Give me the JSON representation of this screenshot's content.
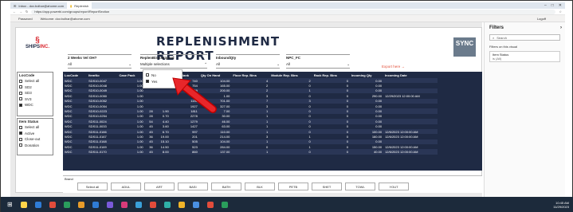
{
  "browser": {
    "tabs": [
      {
        "label": "Inbox - dov.bolhar@ahome.com"
      },
      {
        "label": "Replenish"
      }
    ],
    "url": "https://app.powerbi.com/groups/report/ReportSection",
    "window_controls": [
      "–",
      "□",
      "✕"
    ]
  },
  "pbi_bar": {
    "items": [
      "Password",
      "Welcome: dov.bolhar@ahome.com"
    ],
    "logoff": "Logoff"
  },
  "report": {
    "logo_brand": "SHIPS",
    "logo_suffix": "INC.",
    "title": "REPLENISHMENT REPORT",
    "sync_logo": "SYNC",
    "export_label": "Export here"
  },
  "slicers": [
    {
      "label": "2 Weeks Vel OH?",
      "value": "All"
    },
    {
      "label": "ReplenBinAssigned",
      "value": "Multiple selections"
    },
    {
      "label": "InboundQty",
      "value": "All"
    },
    {
      "label": "NPC_FC",
      "value": "All"
    }
  ],
  "replen_dropdown": {
    "options": [
      {
        "label": "No",
        "checked": false
      },
      {
        "label": "Yes",
        "checked": true
      }
    ]
  },
  "loc_code": {
    "header": "LocCode",
    "options": [
      {
        "label": "Select all",
        "checked": false
      },
      {
        "label": "SD2",
        "checked": false
      },
      {
        "label": "SD3",
        "checked": false
      },
      {
        "label": "SV3",
        "checked": false
      },
      {
        "label": "WDC",
        "checked": true
      }
    ]
  },
  "item_status": {
    "header": "Item Status",
    "options": [
      {
        "label": "Select all",
        "checked": false
      },
      {
        "label": "Active",
        "checked": true
      },
      {
        "label": "Close-out",
        "checked": false
      },
      {
        "label": "Donation",
        "checked": false
      }
    ]
  },
  "table": {
    "columns": [
      "LocCode",
      "ItemNo",
      "Case Pack",
      "",
      "",
      "Sales Rank",
      "Qty On Hand",
      "Floor Rep. Bins",
      "Module Rep. Bins",
      "Rack Rep. Bins",
      "Incoming Qty",
      "Incoming Date"
    ],
    "rows": [
      [
        "WDC",
        "SDS10-0047",
        "1.00",
        "",
        "",
        "740",
        "104.00",
        "4",
        "2",
        "0",
        "0.00",
        ""
      ],
      [
        "WDC",
        "SDS10-0048",
        "1.00",
        "",
        "",
        "754",
        "165.00",
        "2",
        "0",
        "0",
        "0.00",
        ""
      ],
      [
        "WDC",
        "SDS10-0049",
        "1.00",
        "",
        "",
        "1059",
        "200.00",
        "2",
        "1",
        "0",
        "0.00",
        ""
      ],
      [
        "WDC",
        "SDS10-0050",
        "1.00",
        "",
        "",
        "840",
        "1.00",
        "3",
        "0",
        "0",
        "290.00",
        "12/29/2023 12:00:00 AM"
      ],
      [
        "WDC",
        "SDS10-0052",
        "1.00",
        "",
        "",
        "1150",
        "701.00",
        "7",
        "3",
        "0",
        "0.00",
        ""
      ],
      [
        "WDC",
        "SDS10-0054",
        "1.00",
        "",
        "",
        "1927",
        "327.00",
        "3",
        "0",
        "0",
        "0.00",
        ""
      ],
      [
        "WDC",
        "SDS10-0223",
        "1.00",
        "28",
        "1.90",
        "1811",
        "7.00",
        "1",
        "0",
        "0",
        "0.00",
        ""
      ],
      [
        "WDC",
        "SDS10-0254",
        "1.00",
        "28",
        "0.70",
        "2278",
        "30.00",
        "1",
        "0",
        "0",
        "0.00",
        ""
      ],
      [
        "WDC",
        "SDS11-0024",
        "1.00",
        "54",
        "4.40",
        "1279",
        "46.00",
        "1",
        "0",
        "0",
        "0.00",
        ""
      ],
      [
        "WDC",
        "SDS11-0033",
        "1.00",
        "45",
        "3.60",
        "1427",
        "63.00",
        "1",
        "0",
        "0",
        "0.00",
        ""
      ],
      [
        "WDC",
        "SDS11-0166",
        "1.00",
        "45",
        "6.70",
        "997",
        "110.00",
        "1",
        "0",
        "0",
        "100.00",
        "12/6/2023 12:00:00 AM"
      ],
      [
        "WDC",
        "SDS11-0167",
        "1.00",
        "36",
        "19.00",
        "201",
        "214.00",
        "3",
        "1",
        "0",
        "160.00",
        "12/6/2023 12:00:00 AM"
      ],
      [
        "WDC",
        "SDS11-0168",
        "1.00",
        "45",
        "15.10",
        "505",
        "104.00",
        "1",
        "0",
        "0",
        "0.00",
        ""
      ],
      [
        "WDC",
        "SDS11-0169",
        "1.00",
        "36",
        "14.50",
        "523",
        "284.00",
        "0",
        "1",
        "0",
        "150.00",
        "12/6/2023 12:00:00 AM"
      ],
      [
        "WDC",
        "SDS11-0170",
        "1.00",
        "45",
        "8.00",
        "860",
        "137.00",
        "1",
        "0",
        "0",
        "40.00",
        "12/6/2023 12:00:00 AM"
      ]
    ]
  },
  "brands": {
    "label": "Brand",
    "items": [
      "Select all",
      "ADUL",
      "ART",
      "BASI",
      "BATH",
      "BLK",
      "PETB",
      "SHET",
      "TOWL",
      "YOUT"
    ]
  },
  "filters_pane": {
    "title": "Filters",
    "search_placeholder": "Search",
    "section": "Filters on this visual",
    "card_label": "Item Status",
    "card_value": "is (All)"
  },
  "taskbar": {
    "time": "10:45 AM",
    "date": "11/29/2023",
    "icon_colors": [
      "#ffd54a",
      "#2f7cd6",
      "#e24c3b",
      "#2a9d5c",
      "#e89c2a",
      "#2f7cd6",
      "#7a5ad9",
      "#d83b7a",
      "#3aa0d8",
      "#e24c3b",
      "#2fb0a8",
      "#f0b429",
      "#4a90e2",
      "#e24c3b",
      "#2a9d5c"
    ]
  },
  "colors": {
    "grid_dark": "#1f2a44",
    "accent_red": "#d8262e",
    "export_red": "#e2513b"
  }
}
